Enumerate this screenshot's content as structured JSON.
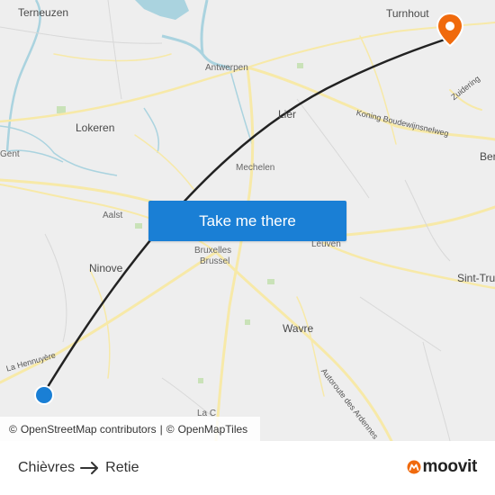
{
  "map": {
    "places": [
      {
        "name": "Terneuzen",
        "size": "lg"
      },
      {
        "name": "Turnhout",
        "size": "lg"
      },
      {
        "name": "Antwerpen",
        "size": "sm"
      },
      {
        "name": "Lier",
        "size": "lg"
      },
      {
        "name": "Lokeren",
        "size": "lg"
      },
      {
        "name": "Gent",
        "size": "sm"
      },
      {
        "name": "Mechelen",
        "size": "sm"
      },
      {
        "name": "Aalst",
        "size": "sm"
      },
      {
        "name": "Ninove",
        "size": "lg"
      },
      {
        "name": "Bruxelles",
        "size": "sm"
      },
      {
        "name": "Brussel",
        "size": "sm"
      },
      {
        "name": "Leuven",
        "size": "sm"
      },
      {
        "name": "Wavre",
        "size": "lg"
      },
      {
        "name": "Sint-Trui",
        "size": "lg"
      },
      {
        "name": "Ber",
        "size": "lg"
      },
      {
        "name": "La C",
        "size": "sm"
      }
    ],
    "roads": [
      {
        "name": "Koning Boudewijnsnelweg"
      },
      {
        "name": "Zuidering"
      },
      {
        "name": "La Hennuyère"
      },
      {
        "name": "Autoroute des Ardennes"
      }
    ],
    "colors": {
      "land": "#eeeeee",
      "water": "#aad3df",
      "road": "#f7e9a8",
      "route_line": "#222222",
      "origin": "#1a7fd5",
      "destination": "#f06a0d"
    }
  },
  "cta": {
    "label": "Take me there"
  },
  "attribution": {
    "symbol": "©",
    "osm": "OpenStreetMap contributors",
    "separator": "|",
    "tiles": "OpenMapTiles"
  },
  "route": {
    "from": "Chièvres",
    "to": "Retie"
  },
  "brand": {
    "name": "moovit"
  },
  "icons": {
    "origin": "origin-dot-icon",
    "destination": "destination-pin-icon",
    "arrow": "arrow-right-icon",
    "logo": "moovit-logo-icon"
  }
}
